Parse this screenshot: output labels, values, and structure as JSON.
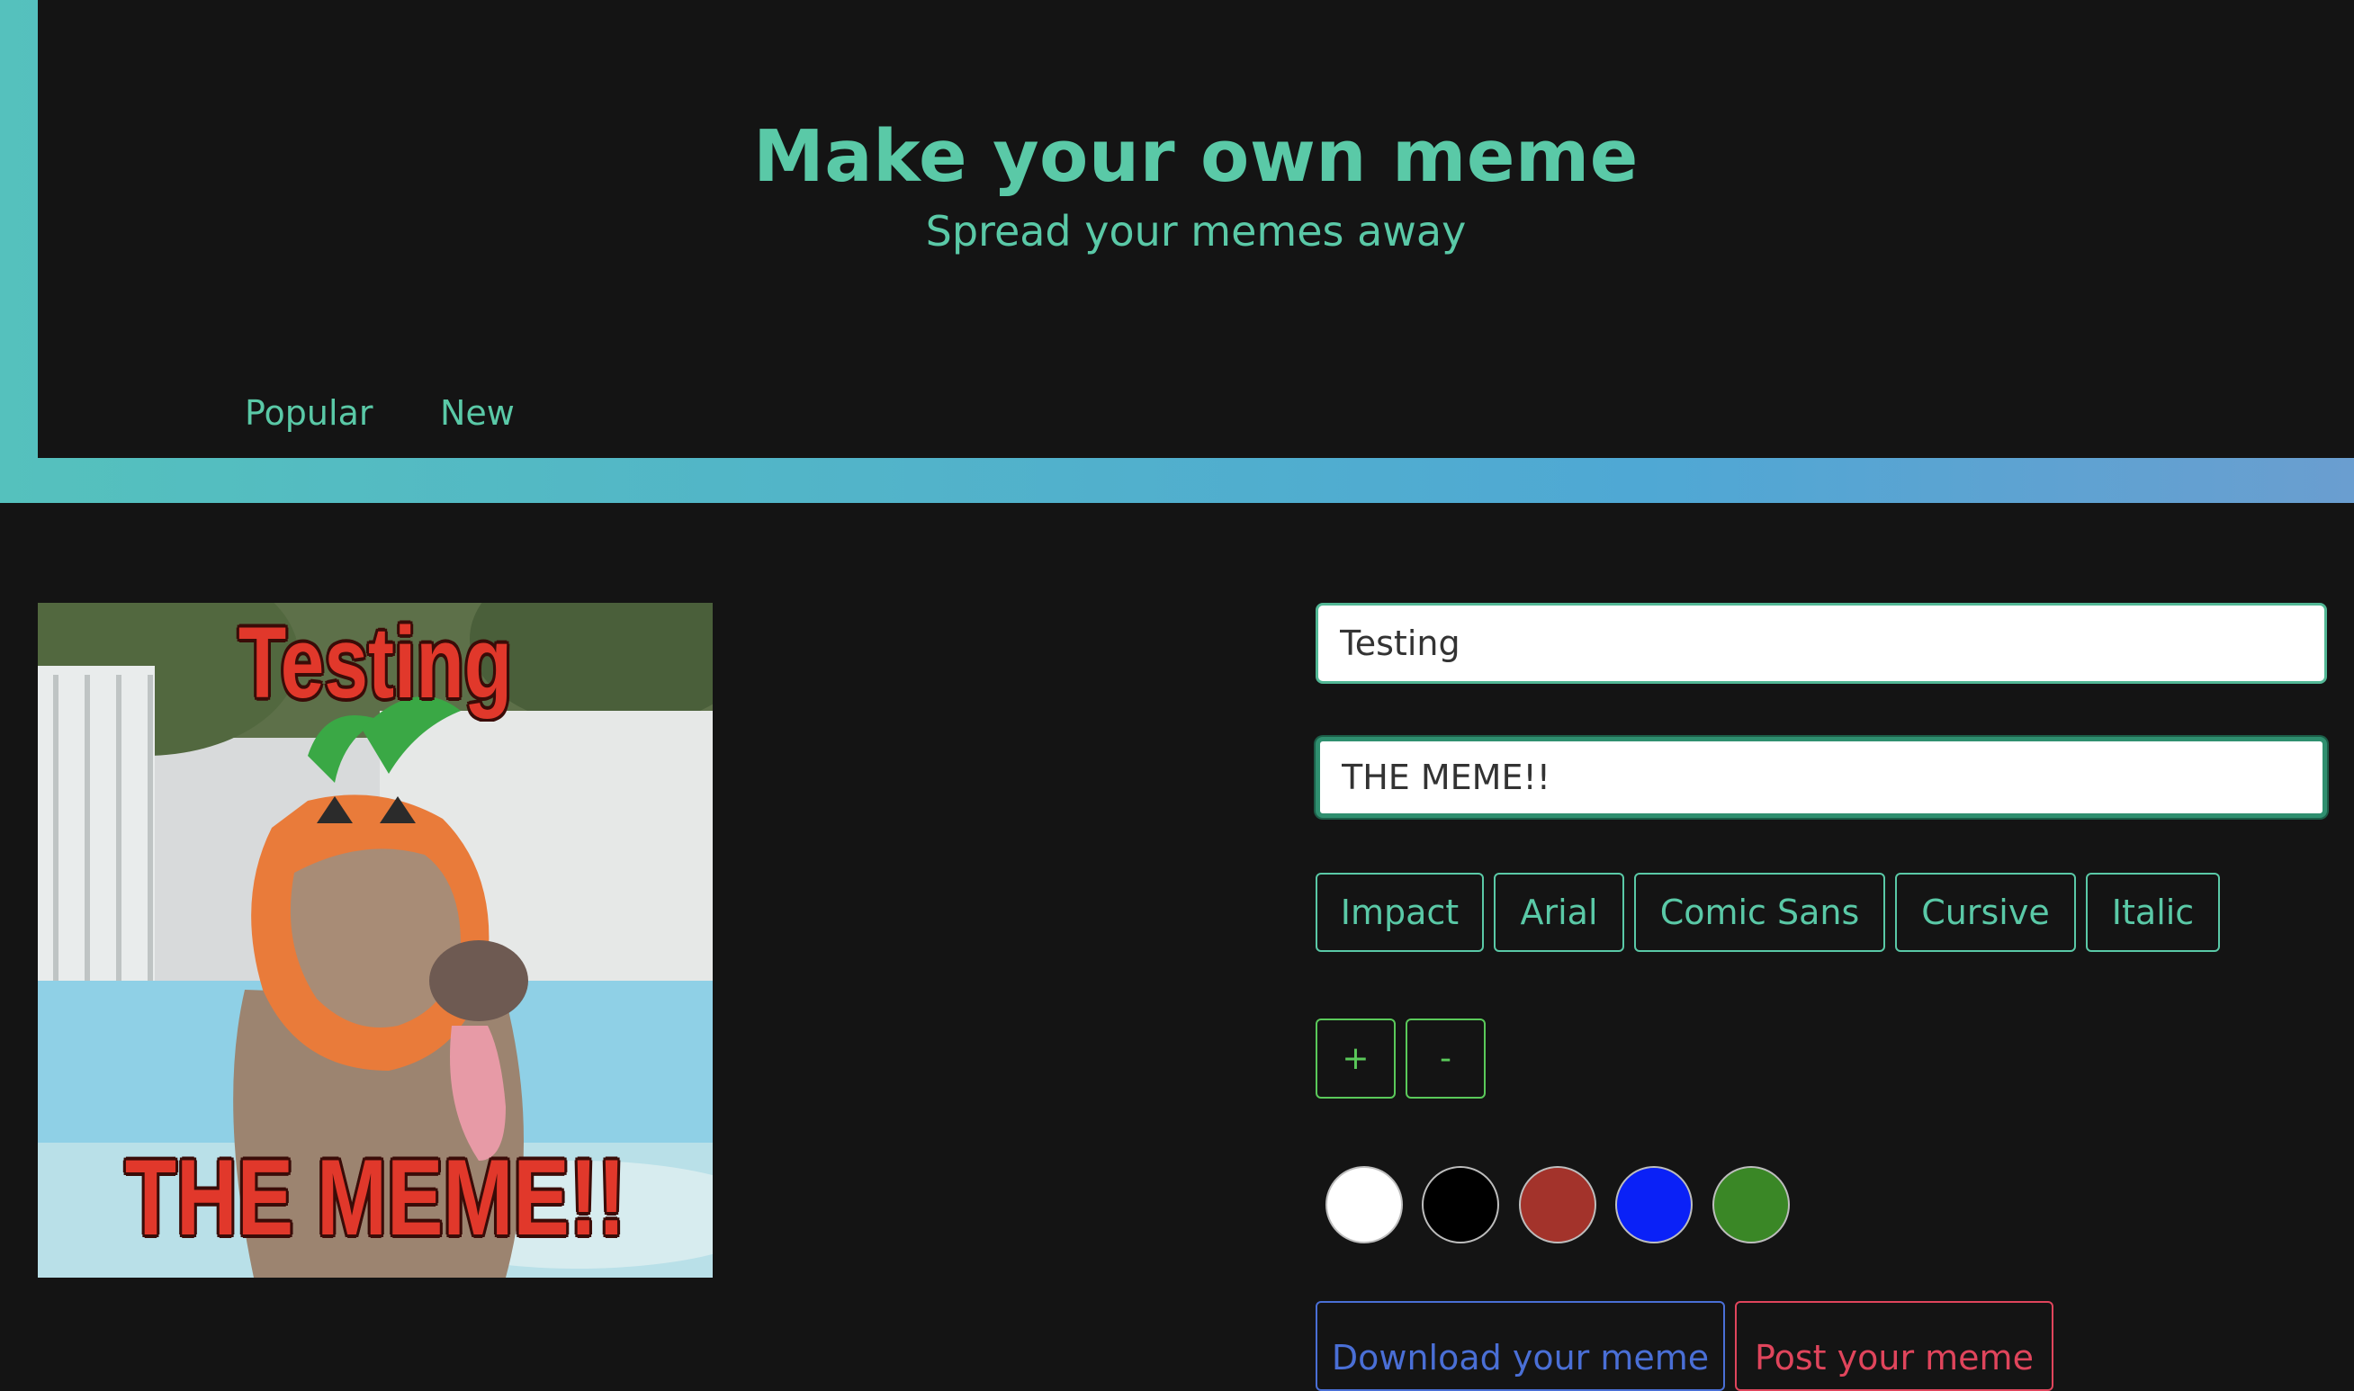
{
  "header": {
    "title": "Make your own meme",
    "subtitle": "Spread your memes away",
    "nav": [
      {
        "label": "Popular"
      },
      {
        "label": "New"
      }
    ]
  },
  "preview": {
    "top_text": "Testing",
    "bottom_text": "THE MEME!!"
  },
  "editor": {
    "top_input_value": "Testing",
    "bottom_input_value": "THE MEME!!",
    "fonts": [
      "Impact",
      "Arial",
      "Comic Sans",
      "Cursive",
      "Italic"
    ],
    "size_increase_label": "+",
    "size_decrease_label": "-",
    "colors": [
      {
        "name": "white",
        "hex": "#ffffff"
      },
      {
        "name": "black",
        "hex": "#000000"
      },
      {
        "name": "red",
        "hex": "#a3332b"
      },
      {
        "name": "blue",
        "hex": "#0a21f7"
      },
      {
        "name": "green",
        "hex": "#3a8726"
      }
    ],
    "download_label": "Download your meme",
    "post_label": "Post your meme"
  },
  "theme": {
    "accent": "#5ac9a7",
    "background": "#141414",
    "download_color": "#4a6fd6",
    "post_color": "#e0455c"
  }
}
